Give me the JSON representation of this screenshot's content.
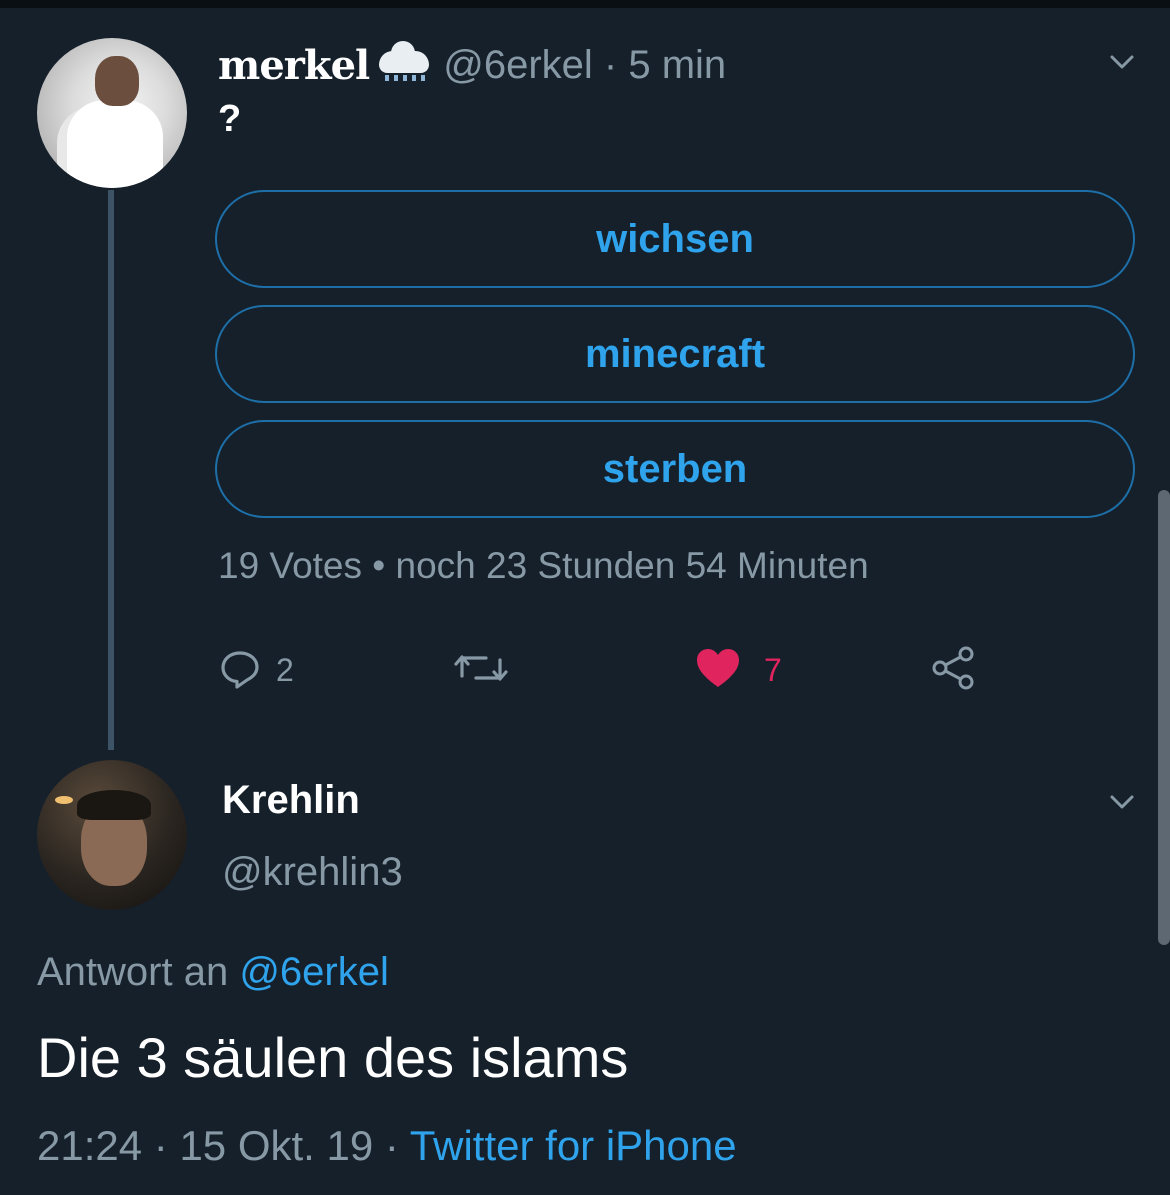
{
  "poll_tweet": {
    "display_name": "merkel",
    "handle": "@6erkel",
    "time_sep": " · ",
    "time": "5 min",
    "text": "?",
    "options": [
      {
        "label": "wichsen"
      },
      {
        "label": "minecraft"
      },
      {
        "label": "sterben"
      }
    ],
    "votes": "19 Votes",
    "meta_sep": " • ",
    "remaining": "noch 23 Stunden 54 Minuten",
    "reply_count": "2",
    "like_count": "7",
    "like_color": "#e0245e"
  },
  "reply_tweet": {
    "display_name": "Krehlin",
    "handle": "@krehlin3",
    "reply_prefix": "Antwort an ",
    "reply_to": "@6erkel",
    "text": "Die 3 säulen des islams",
    "time": "21:24",
    "sep1": " · ",
    "date": "15 Okt. 19",
    "sep2": " · ",
    "client": "Twitter for iPhone"
  },
  "icons": [
    "snow-cloud-icon",
    "chevron-down-icon",
    "reply-icon",
    "retweet-icon",
    "heart-icon",
    "share-icon"
  ],
  "colors": {
    "background": "#15202b",
    "accent": "#2fa3ec",
    "secondary_text": "#8899a6"
  }
}
